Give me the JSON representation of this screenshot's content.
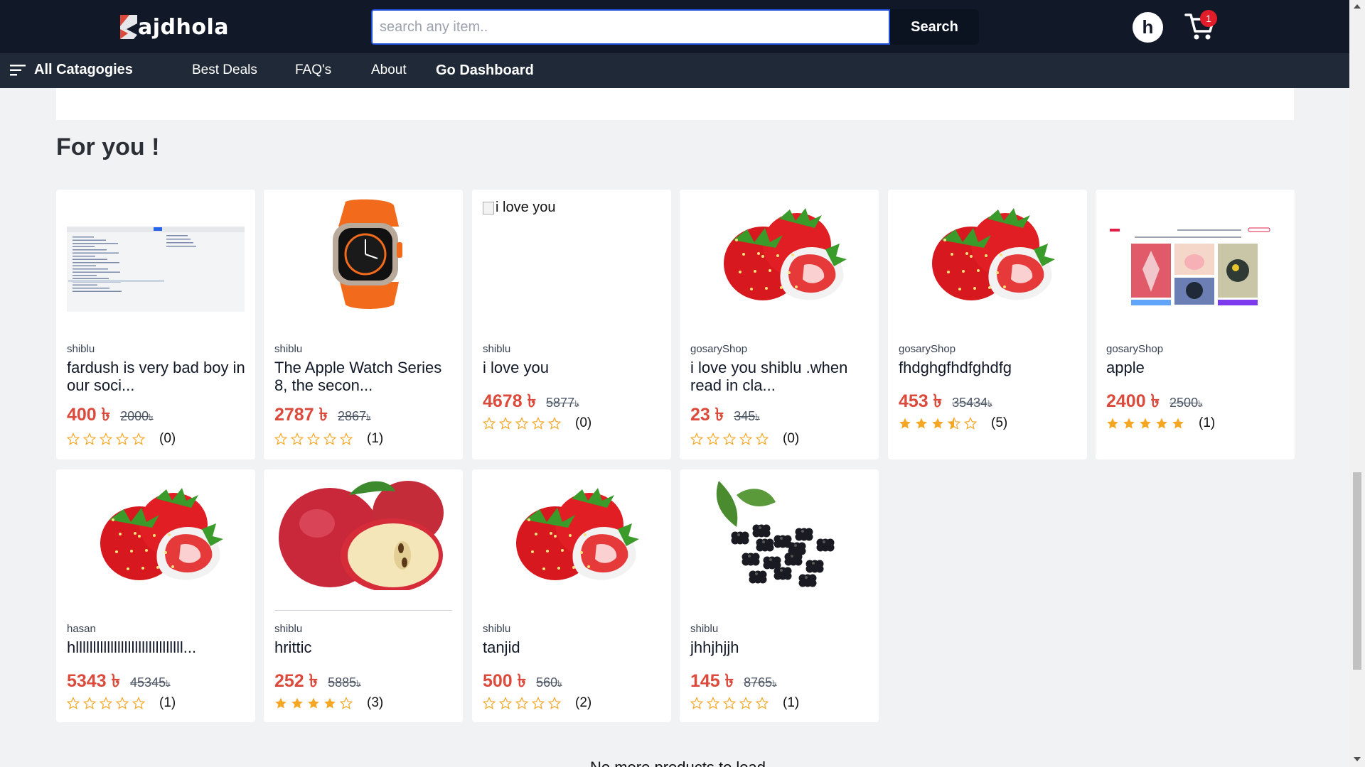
{
  "brand": {
    "name": "ajdhola",
    "accent": "#dc4a3c"
  },
  "search": {
    "placeholder": "search any item..",
    "button_label": "Search"
  },
  "user": {
    "initial": "h"
  },
  "cart": {
    "count": "1"
  },
  "nav": {
    "categories_label": "All Catagogies",
    "links": [
      "Best Deals",
      "FAQ's",
      "About",
      "Go Dashboard"
    ]
  },
  "section": {
    "title": "For you !"
  },
  "products": [
    {
      "seller": "shiblu",
      "title": "fardush is very bad boy in our soci...",
      "price": "400",
      "old_price": "2000",
      "rating": 0,
      "count": "(0)",
      "image": "code-screenshot"
    },
    {
      "seller": "shiblu",
      "title": "The Apple Watch Series 8, the secon...",
      "price": "2787",
      "old_price": "2867",
      "rating": 0,
      "count": "(1)",
      "image": "apple-watch"
    },
    {
      "seller": "shiblu",
      "title": "i love you",
      "price": "4678",
      "old_price": "5877",
      "rating": 0,
      "count": "(0)",
      "image": "broken",
      "alt": "i love you"
    },
    {
      "seller": "gosaryShop",
      "title": "i love you shiblu .when read in cla...",
      "price": "23",
      "old_price": "345",
      "rating": 0,
      "count": "(0)",
      "image": "strawberry"
    },
    {
      "seller": "gosaryShop",
      "title": "fhdghgfhdfghdfg",
      "price": "453",
      "old_price": "35434",
      "rating": 3.5,
      "count": "(5)",
      "image": "strawberry"
    },
    {
      "seller": "gosaryShop",
      "title": "apple",
      "price": "2400",
      "old_price": "2500",
      "rating": 5,
      "count": "(1)",
      "image": "nft-site"
    },
    {
      "seller": "hasan",
      "title": "hlllllllllllllllllllllllllllllll...",
      "price": "5343",
      "old_price": "45345",
      "rating": 0,
      "count": "(1)",
      "image": "strawberry"
    },
    {
      "seller": "shiblu",
      "title": "hrittic",
      "price": "252",
      "old_price": "5885",
      "rating": 4,
      "count": "(3)",
      "image": "apples"
    },
    {
      "seller": "shiblu",
      "title": "tanjid",
      "price": "500",
      "old_price": "560",
      "rating": 0,
      "count": "(2)",
      "image": "strawberry"
    },
    {
      "seller": "shiblu",
      "title": "jhhjhjjh",
      "price": "145",
      "old_price": "8765",
      "rating": 0,
      "count": "(1)",
      "image": "blackberry"
    }
  ],
  "currency": {
    "symbol": "৳"
  },
  "footer_text": "No more products to load"
}
